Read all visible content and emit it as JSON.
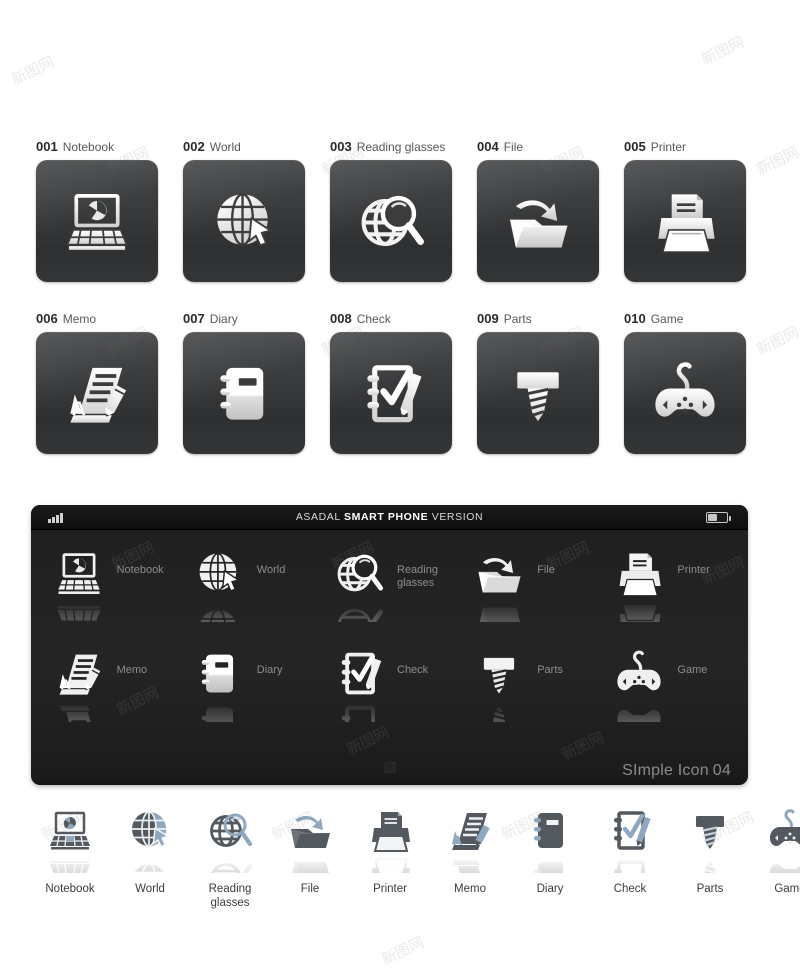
{
  "icon_set": {
    "items": [
      {
        "number": "001",
        "name": "Notebook",
        "icon": "notebook-icon",
        "phone_label": "Notebook",
        "strip_label": "Notebook"
      },
      {
        "number": "002",
        "name": "World",
        "icon": "world-globe-cursor-icon",
        "phone_label": "World",
        "strip_label": "World"
      },
      {
        "number": "003",
        "name": "Reading glasses",
        "icon": "globe-magnifier-icon",
        "phone_label": "Reading glasses",
        "strip_label": "Reading glasses"
      },
      {
        "number": "004",
        "name": "File",
        "icon": "folder-upload-icon",
        "phone_label": "File",
        "strip_label": "File"
      },
      {
        "number": "005",
        "name": "Printer",
        "icon": "printer-icon",
        "phone_label": "Printer",
        "strip_label": "Printer"
      },
      {
        "number": "006",
        "name": "Memo",
        "icon": "memo-pencil-icon",
        "phone_label": "Memo",
        "strip_label": "Memo"
      },
      {
        "number": "007",
        "name": "Diary",
        "icon": "diary-notebook-icon",
        "phone_label": "Diary",
        "strip_label": "Diary"
      },
      {
        "number": "008",
        "name": "Check",
        "icon": "checklist-pencil-icon",
        "phone_label": "Check",
        "strip_label": "Check"
      },
      {
        "number": "009",
        "name": "Parts",
        "icon": "screw-bolt-icon",
        "phone_label": "Parts",
        "strip_label": "Parts"
      },
      {
        "number": "010",
        "name": "Game",
        "icon": "gamepad-icon",
        "phone_label": "Game",
        "strip_label": "Game"
      }
    ]
  },
  "phone": {
    "title_prefix": "ASADAL",
    "title_bold": "SMART PHONE",
    "title_suffix": "VERSION",
    "brand_name": "SImple Icon",
    "brand_number": "04",
    "status_signal": "signal-bars-icon",
    "status_battery": "battery-icon",
    "home_button": "home-button"
  },
  "colors": {
    "tile_background": "#3a3c3e",
    "tile_glyph": "#f2f2f2",
    "phone_background": "#202020",
    "phone_label": "#8d8d8d",
    "strip_glyph_dark": "#53595e",
    "strip_glyph_blue": "#8fa8bf",
    "caption_number": "#2a2a2a",
    "caption_name": "#585858",
    "page_background": "#ffffff"
  },
  "watermark": {
    "text": "新图网"
  }
}
